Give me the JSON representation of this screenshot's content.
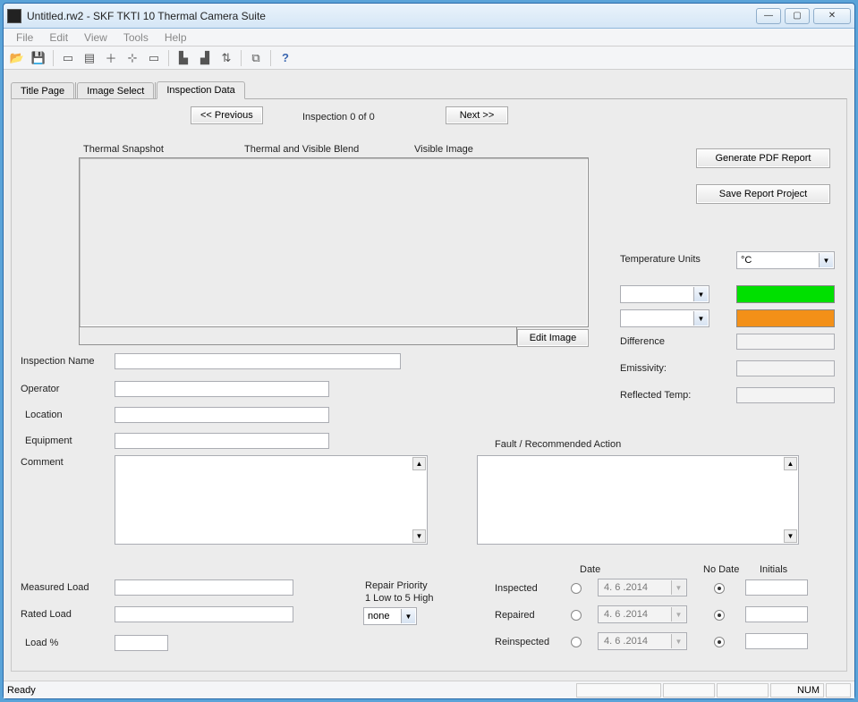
{
  "window": {
    "title": "Untitled.rw2 - SKF TKTI 10 Thermal Camera Suite"
  },
  "menu": {
    "file": "File",
    "edit": "Edit",
    "view": "View",
    "tools": "Tools",
    "help": "Help"
  },
  "tabs": {
    "title_page": "Title Page",
    "image_select": "Image Select",
    "inspection_data": "Inspection Data"
  },
  "nav": {
    "prev": "<< Previous",
    "next": "Next >>",
    "inspection_counter": "Inspection 0 of 0"
  },
  "image_headers": {
    "thermal": "Thermal Snapshot",
    "blend": "Thermal and Visible Blend",
    "visible": "Visible Image"
  },
  "buttons": {
    "edit_image": "Edit Image",
    "gen_pdf": "Generate PDF Report",
    "save_report": "Save Report Project"
  },
  "labels": {
    "inspection_name": "Inspection Name",
    "operator": "Operator",
    "location": "Location",
    "equipment": "Equipment",
    "comment": "Comment",
    "temp_units": "Temperature Units",
    "difference": "Difference",
    "emissivity": "Emissivity:",
    "reflected_temp": "Reflected Temp:",
    "fault_action": "Fault / Recommended Action",
    "measured_load": "Measured Load",
    "rated_load": "Rated Load",
    "load_pct": "Load %",
    "repair_priority": "Repair Priority",
    "repair_priority_sub": "1 Low to 5 High",
    "date": "Date",
    "no_date": "No Date",
    "initials": "Initials",
    "inspected": "Inspected",
    "repaired": "Repaired",
    "reinspected": "Reinspected"
  },
  "values": {
    "temp_units": "°C",
    "repair_priority": "none",
    "inspected_date": "4. 6 .2014",
    "repaired_date": "4. 6 .2014",
    "reinspected_date": "4. 6 .2014"
  },
  "colors": {
    "swatch1": "#00e000",
    "swatch2": "#f39018"
  },
  "status": {
    "ready": "Ready",
    "num": "NUM"
  }
}
